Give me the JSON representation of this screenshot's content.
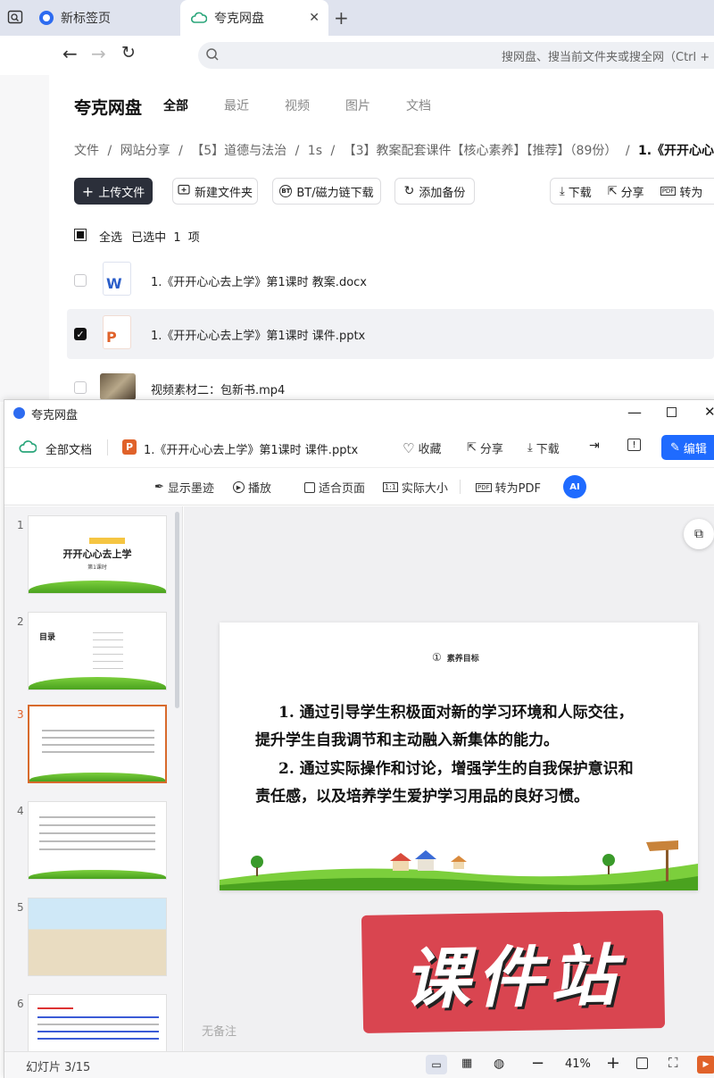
{
  "browser": {
    "tabs": [
      {
        "label": "新标签页"
      },
      {
        "label": "夸克网盘"
      }
    ],
    "omnibox_placeholder": "搜网盘、搜当前文件夹或搜全网（Ctrl + F"
  },
  "drive": {
    "logo": "夸克网盘",
    "nav": [
      "全部",
      "最近",
      "视频",
      "图片",
      "文档"
    ],
    "breadcrumb": [
      "文件",
      "网站分享",
      "【5】道德与法治",
      "1s",
      "【3】教案配套课件【核心素养】【推荐】（89份）",
      "1.《开开心心去上"
    ],
    "sep": "/",
    "actions": {
      "upload": "上传文件",
      "newfolder": "新建文件夹",
      "bt": "BT/磁力链下载",
      "backup": "添加备份",
      "download": "下载",
      "share": "分享",
      "topdf": "转为"
    },
    "select_all": "全选",
    "selected_text": "已选中",
    "selected_count": "1",
    "selected_unit": "项",
    "files": [
      {
        "name": "1.《开开心心去上学》第1课时 教案.docx",
        "icon": "W",
        "color": "#2b5ec9",
        "checked": false
      },
      {
        "name": "1.《开开心心去上学》第1课时 课件.pptx",
        "icon": "P",
        "color": "#e0622a",
        "checked": true
      },
      {
        "name": "视频素材二：包新书.mp4",
        "icon": "video",
        "color": "#8a7a60",
        "checked": false
      }
    ]
  },
  "viewer": {
    "window_title": "夸克网盘",
    "all_docs": "全部文档",
    "file_title": "1.《开开心心去上学》第1课时 课件.pptx",
    "actions": {
      "collect": "收藏",
      "share": "分享",
      "download": "下载",
      "edit": "编辑"
    },
    "tools": {
      "ink": "显示墨迹",
      "play": "播放",
      "fit": "适合页面",
      "actual": "实际大小",
      "topdf": "转为PDF"
    },
    "thumb_labels": [
      "1",
      "2",
      "3",
      "4",
      "5",
      "6"
    ],
    "thumb1_title": "开开心心去上学",
    "thumb1_sub": "第1课时",
    "thumb2_title": "目录",
    "slide": {
      "badge_num": "①",
      "badge_text": "素养目标",
      "lines": [
        "1. 通过引导学生积极面对新的学习环境和人际交往，",
        "提升学生自我调节和主动融入新集体的能力。",
        "2. 通过实际操作和讨论，增强学生的自我保护意识和",
        "责任感，以及培养学生爱护学习用品的良好习惯。"
      ]
    },
    "no_notes": "无备注",
    "status_slide": "幻灯片 3/15",
    "zoom": "41%",
    "watermark": "课件站"
  }
}
